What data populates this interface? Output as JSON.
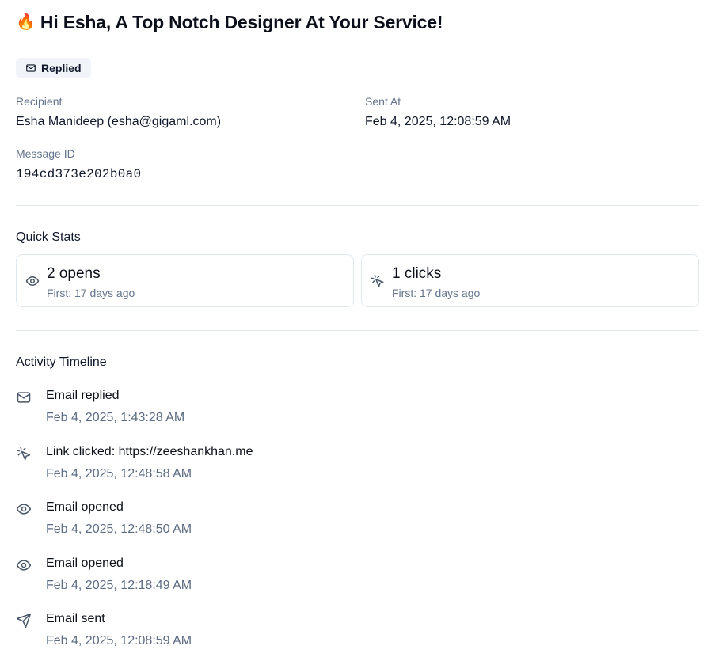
{
  "header": {
    "emoji": "🔥",
    "title": "Hi Esha, A Top Notch Designer At Your Service!"
  },
  "status_badge": {
    "icon": "mail-icon",
    "label": "Replied"
  },
  "details": {
    "recipient_label": "Recipient",
    "recipient_value": "Esha Manideep (esha@gigaml.com)",
    "sent_at_label": "Sent At",
    "sent_at_value": "Feb 4, 2025, 12:08:59 AM",
    "message_id_label": "Message ID",
    "message_id_value": "194cd373e202b0a0"
  },
  "quick_stats": {
    "title": "Quick Stats",
    "opens": {
      "icon": "eye-icon",
      "value": "2 opens",
      "sub": "First: 17 days ago"
    },
    "clicks": {
      "icon": "pointer-click-icon",
      "value": "1 clicks",
      "sub": "First: 17 days ago"
    }
  },
  "timeline": {
    "title": "Activity Timeline",
    "items": [
      {
        "icon": "mail-icon",
        "event": "Email replied",
        "time": "Feb 4, 2025, 1:43:28 AM"
      },
      {
        "icon": "pointer-click-icon",
        "event": "Link clicked: https://zeeshankhan.me",
        "time": "Feb 4, 2025, 12:48:58 AM"
      },
      {
        "icon": "eye-icon",
        "event": "Email opened",
        "time": "Feb 4, 2025, 12:48:50 AM"
      },
      {
        "icon": "eye-icon",
        "event": "Email opened",
        "time": "Feb 4, 2025, 12:18:49 AM"
      },
      {
        "icon": "send-icon",
        "event": "Email sent",
        "time": "Feb 4, 2025, 12:08:59 AM"
      }
    ]
  },
  "colors": {
    "muted_text": "#64748b",
    "border": "#e2e8f0",
    "badge_bg": "#f1f5f9",
    "icon_stroke": "#475569"
  }
}
